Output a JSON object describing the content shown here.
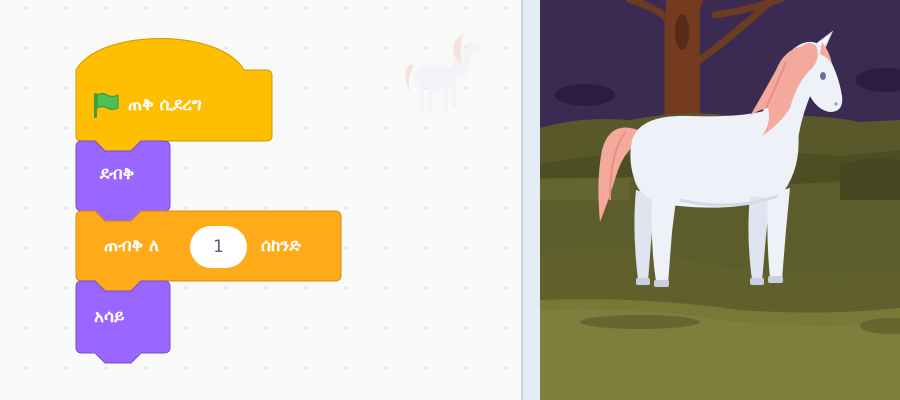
{
  "script": {
    "hat_block": {
      "label": "ጠቅ ሲደረግ",
      "icon": "green-flag-icon",
      "color": "#ffbf00"
    },
    "blocks": [
      {
        "label": "ደብቅ",
        "category": "looks",
        "color": "#9966ff"
      },
      {
        "label_before": "ጠብቅ ለ",
        "input_value": "1",
        "label_after": "ሰከንድ",
        "category": "control",
        "color": "#ffab19"
      },
      {
        "label": "አሳይ",
        "category": "looks",
        "color": "#9966ff"
      }
    ]
  },
  "stage": {
    "sprite": "unicorn",
    "backdrop": "night-forest"
  }
}
